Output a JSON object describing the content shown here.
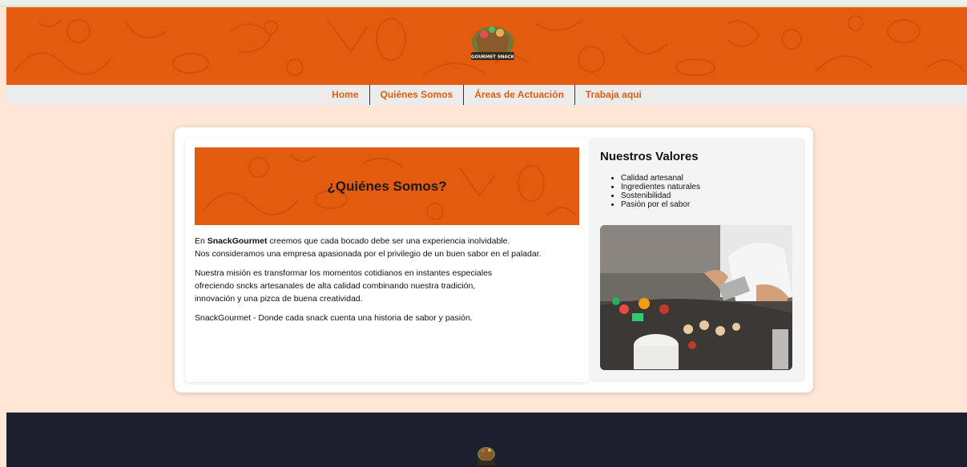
{
  "brand": {
    "logo_text": "GOURMET SNACK"
  },
  "nav": {
    "items": [
      {
        "label": "Home"
      },
      {
        "label": "Quiénes Somos"
      },
      {
        "label": "Áreas de Actuación"
      },
      {
        "label": "Trabaja aqui"
      }
    ]
  },
  "hero": {
    "title": "¿Quiénes Somos?"
  },
  "about": {
    "p1_prefix": "En ",
    "p1_brand": "SnackGourmet",
    "p1_line1_rest": " creemos que cada bocado debe ser una experiencia inolvidable.",
    "p1_line2": "Nos consideramos una empresa apasionada por el privilegio de un buen sabor en el paladar.",
    "p2_line1": "Nuestra misión es transformar los momentos cotidianos en instantes especiales",
    "p2_line2": "ofreciendo sncks artesanales de alta calidad combinando nuestra tradición,",
    "p2_line3": "innovación y una pizca de buena creatividad.",
    "p3": "SnackGourmet - Donde cada snack cuenta una historia de sabor y pasión."
  },
  "values": {
    "title": "Nuestros Valores",
    "items": [
      "Calidad artesanal",
      "Ingredientes naturales",
      "Sostenibilidad",
      "Pasión por el sabor"
    ]
  },
  "colors": {
    "accent": "#e35b0e",
    "background": "#ffe6d6",
    "footer": "#1e1f2e",
    "nav_bg": "#ececec"
  }
}
